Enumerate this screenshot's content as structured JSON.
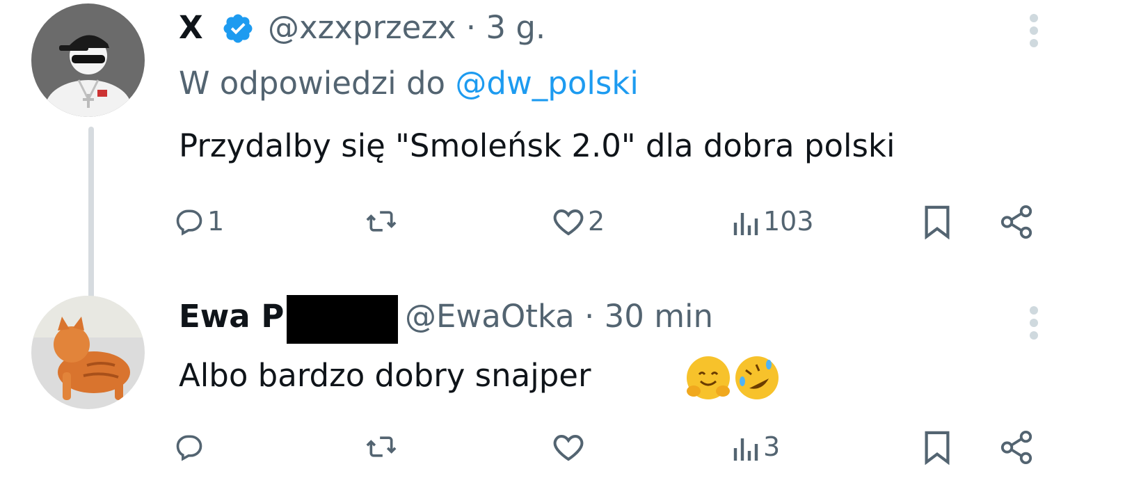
{
  "tweet1": {
    "name": "X",
    "handle_time": "@xzxprzezx · 3 g.",
    "reply_prefix": "W odpowiedzi do ",
    "reply_mention": "@dw_polski",
    "text": "Przydalby się \"Smoleńsk 2.0\" dla dobra polski",
    "actions": {
      "replies": "1",
      "retweets": "",
      "likes": "2",
      "views": "103"
    }
  },
  "tweet2": {
    "name": "Ewa P",
    "handle_time": "@EwaOtka · 30 min",
    "text": "Albo bardzo dobry snajper",
    "emoji": [
      "hugging-face-emoji",
      "rolling-on-floor-laughing-emoji"
    ],
    "actions": {
      "replies": "",
      "retweets": "",
      "likes": "",
      "views": "3"
    }
  },
  "colors": {
    "text": "#0f1419",
    "secondary": "#536471",
    "link": "#1d9bf0",
    "verified": "#1d9bf0",
    "thread_line": "#d6dbdf"
  },
  "icons": [
    "verified-badge-icon",
    "more-options-icon",
    "reply-icon",
    "retweet-icon",
    "like-icon",
    "views-icon",
    "bookmark-icon",
    "share-icon"
  ]
}
